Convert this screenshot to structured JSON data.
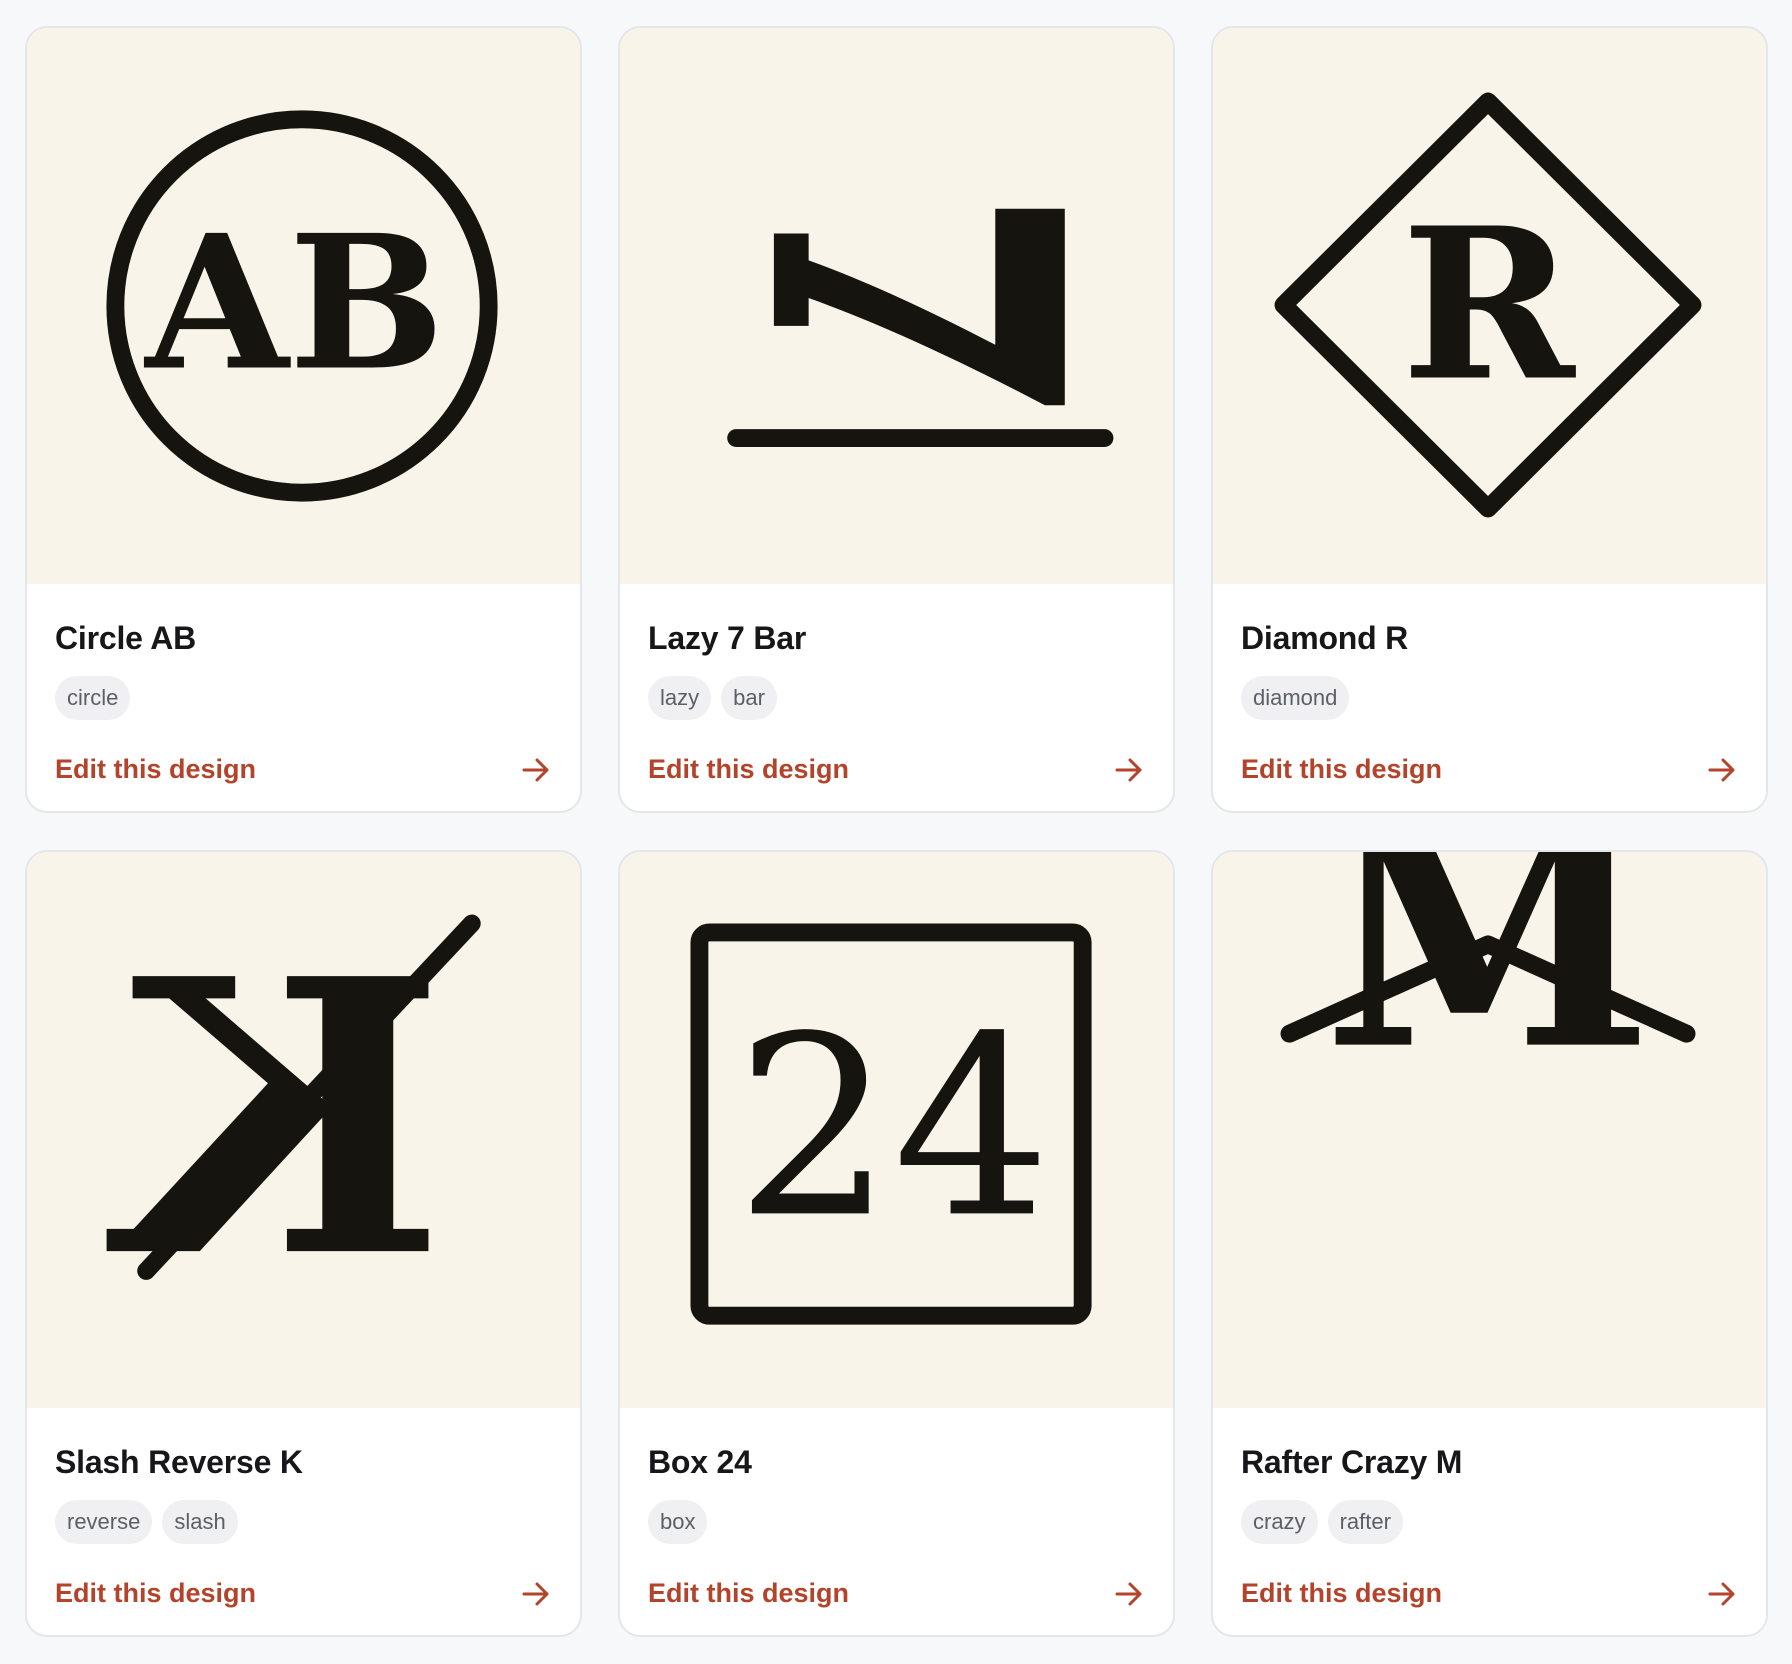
{
  "colors": {
    "page_bg": "#f7f8fa",
    "card_bg": "#ffffff",
    "preview_bg": "#f8f4e9",
    "ink": "#15140f",
    "accent": "#b3432a",
    "tag_bg": "#f0f0f2",
    "tag_text": "#5d5f66"
  },
  "cards": [
    {
      "title": "Circle AB",
      "tags": [
        "circle"
      ],
      "edit_label": "Edit this design",
      "preview": {
        "glyph": "AB"
      }
    },
    {
      "title": "Lazy 7 Bar",
      "tags": [
        "lazy",
        "bar"
      ],
      "edit_label": "Edit this design",
      "preview": {
        "glyph": "7"
      }
    },
    {
      "title": "Diamond R",
      "tags": [
        "diamond"
      ],
      "edit_label": "Edit this design",
      "preview": {
        "glyph": "R"
      }
    },
    {
      "title": "Slash Reverse K",
      "tags": [
        "reverse",
        "slash"
      ],
      "edit_label": "Edit this design",
      "preview": {
        "glyph": "K"
      }
    },
    {
      "title": "Box 24",
      "tags": [
        "box"
      ],
      "edit_label": "Edit this design",
      "preview": {
        "glyph": "24"
      }
    },
    {
      "title": "Rafter Crazy M",
      "tags": [
        "crazy",
        "rafter"
      ],
      "edit_label": "Edit this design",
      "preview": {
        "glyph": "M"
      }
    }
  ],
  "icons": {
    "edit_arrow": "arrow-right-icon"
  }
}
